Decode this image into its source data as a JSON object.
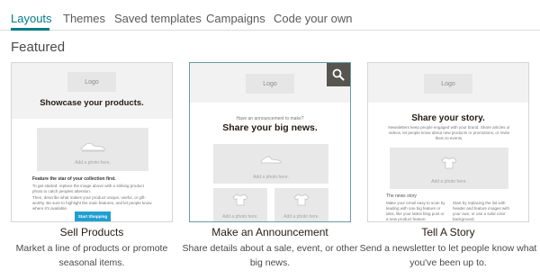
{
  "tabs": [
    {
      "label": "Layouts",
      "active": true
    },
    {
      "label": "Themes",
      "active": false
    },
    {
      "label": "Saved templates",
      "active": false
    },
    {
      "label": "Campaigns",
      "active": false
    },
    {
      "label": "Code your own",
      "active": false
    }
  ],
  "section_title": "Featured",
  "colors": {
    "accent": "#007c89",
    "template_button": "#1f9fd3",
    "search_overlay": "#56554f"
  },
  "cards": [
    {
      "title": "Sell Products",
      "description": "Market a line of products or promote seasonal items.",
      "preview": {
        "logo": "Logo",
        "headline": "Showcase your products.",
        "photo_caption": "Add a photo here.",
        "feature_title": "Feature the star of your collection first.",
        "feature_body_1": "To get started: replace the image above with a striking product photo to catch peoples attention.",
        "feature_body_2": "Then, describe what makes your product unique, useful, or gift-worthy. Be sure to highlight the main features, and let people know where it's available.",
        "button": "Start Shopping"
      }
    },
    {
      "title": "Make an Announcement",
      "description": "Share details about a sale, event, or other big news.",
      "preview": {
        "logo": "Logo",
        "kicker": "Have an announcement to make?",
        "headline": "Share your big news.",
        "photo_caption": "Add a photo here.",
        "photo_caption_2": "Add a photo here.",
        "photo_caption_3": "Add a photo here."
      },
      "overlay_icon": "search-icon"
    },
    {
      "title": "Tell A Story",
      "description": "Send a newsletter to let people know what you've been up to.",
      "preview": {
        "logo": "Logo",
        "headline": "Share your story.",
        "intro": "Newsletters keep people engaged with your brand. Share articles or videos, let people know about new products or promotions, or invite them to events.",
        "photo_caption": "Add a photo here.",
        "story_label": "The news story",
        "col1": "Make your email easy to scan by leading with one big feature or idea, like your latest blog post or a new product feature.",
        "col2": "Start by replacing the list with header and feature images with your own, or use a solid color background."
      }
    }
  ]
}
